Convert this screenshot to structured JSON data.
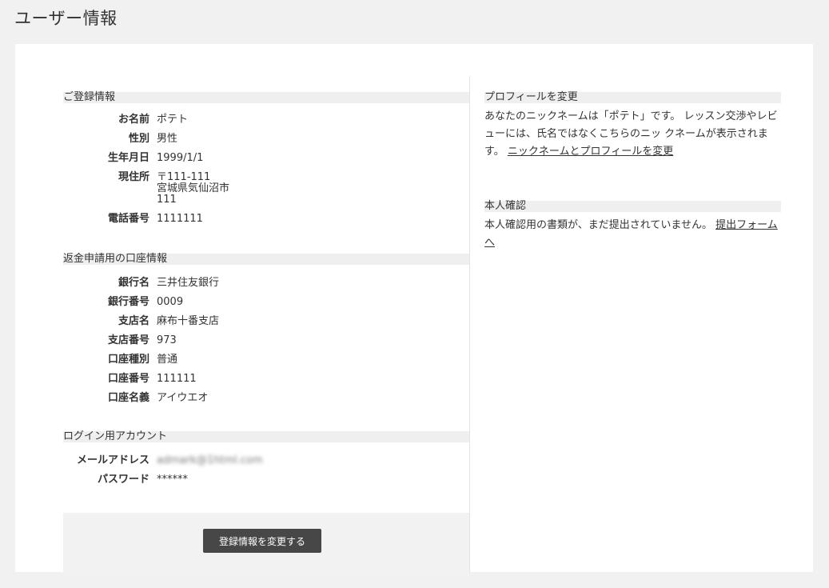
{
  "page": {
    "title": "ユーザー情報"
  },
  "registration": {
    "heading": "ご登録情報",
    "fields": [
      {
        "label": "お名前",
        "value": [
          "ポテト"
        ]
      },
      {
        "label": "性別",
        "value": [
          "男性"
        ]
      },
      {
        "label": "生年月日",
        "value": [
          "1999/1/1"
        ]
      },
      {
        "label": "現住所",
        "value": [
          "〒111-111",
          "宮城県気仙沼市",
          "111"
        ]
      },
      {
        "label": "電話番号",
        "value": [
          "1111111"
        ]
      }
    ]
  },
  "bank": {
    "heading": "返金申請用の口座情報",
    "fields": [
      {
        "label": "銀行名",
        "value": "三井住友銀行"
      },
      {
        "label": "銀行番号",
        "value": "0009"
      },
      {
        "label": "支店名",
        "value": "麻布十番支店"
      },
      {
        "label": "支店番号",
        "value": "973"
      },
      {
        "label": "口座種別",
        "value": "普通"
      },
      {
        "label": "口座番号",
        "value": "111111"
      },
      {
        "label": "口座名義",
        "value": "アイウエオ"
      }
    ]
  },
  "account": {
    "heading": "ログイン用アカウント",
    "email_label": "メールアドレス",
    "email_value": "admark@1html.com",
    "password_label": "パスワード",
    "password_value": "******"
  },
  "actions": {
    "edit_button": "登録情報を変更する"
  },
  "profile": {
    "heading": "プロフィールを変更",
    "lines": [
      "あなたのニックネームは「ポテト」です。",
      "レッスン交渉やレビューには、氏名ではなくこちらのニッ",
      "クネームが表示されます。"
    ],
    "link": "ニックネームとプロフィールを変更"
  },
  "verification": {
    "heading": "本人確認",
    "line": "本人確認用の書類が、まだ提出されていません。",
    "link": "提出フォームへ"
  }
}
